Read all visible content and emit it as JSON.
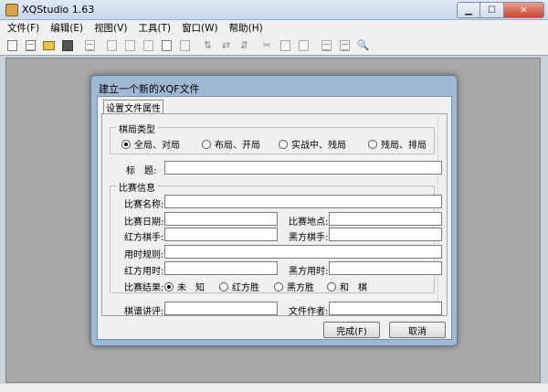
{
  "window": {
    "title": "XQStudio 1.63"
  },
  "menu": [
    "文件(F)",
    "编辑(E)",
    "视图(V)",
    "工具(T)",
    "窗口(W)",
    "帮助(H)"
  ],
  "dialog": {
    "title": "建立一个新的XQF文件",
    "tab": "设置文件属性",
    "game_type": {
      "title": "棋局类型",
      "options": [
        "全局、对局",
        "布局、开局",
        "实战中、残局",
        "残局、排局"
      ],
      "selected_index": 0
    },
    "title_label": "标　题:",
    "title_value": "",
    "match": {
      "title": "比赛信息",
      "name_label": "比赛名称:",
      "date_label": "比赛日期:",
      "place_label": "比赛地点:",
      "red_player_label": "红方棋手:",
      "black_player_label": "黑方棋手:",
      "time_rule_label": "用时规则:",
      "red_time_label": "红方用时:",
      "black_time_label": "黑方用时:",
      "result_label": "比赛结果:",
      "results": [
        "未　知",
        "红方胜",
        "黑方胜",
        "和　棋"
      ],
      "result_selected_index": 0
    },
    "commentator_label": "棋谱讲评:",
    "author_label": "文件作者:",
    "ok_label": "完成(F)",
    "cancel_label": "取消"
  }
}
